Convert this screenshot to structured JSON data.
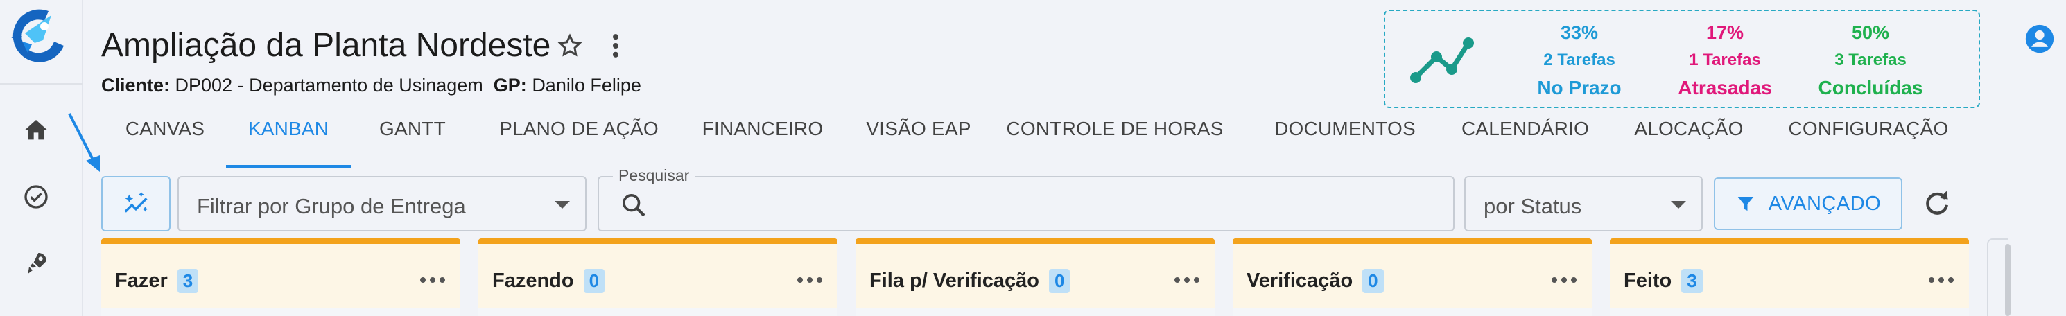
{
  "project": {
    "title": "Ampliação da Planta Nordeste",
    "client_label": "Cliente:",
    "client_value": "DP002 - Departamento de Usinagem",
    "gp_label": "GP:",
    "gp_value": "Danilo Felipe"
  },
  "stats": [
    {
      "pct": "33%",
      "count": "2 Tarefas",
      "label": "No Prazo",
      "color": "#1e9ad6"
    },
    {
      "pct": "17%",
      "count": "1 Tarefas",
      "label": "Atrasadas",
      "color": "#e0187a"
    },
    {
      "pct": "50%",
      "count": "3 Tarefas",
      "label": "Concluídas",
      "color": "#1fb14e"
    }
  ],
  "tabs": [
    "CANVAS",
    "KANBAN",
    "GANTT",
    "PLANO DE AÇÃO",
    "FINANCEIRO",
    "VISÃO EAP",
    "CONTROLE DE HORAS",
    "DOCUMENTOS",
    "CALENDÁRIO",
    "ALOCAÇÃO",
    "CONFIGURAÇÃO"
  ],
  "active_tab": "KANBAN",
  "filters": {
    "group_placeholder": "Filtrar por Grupo de Entrega",
    "search_label": "Pesquisar",
    "search_value": "",
    "status_select": "por Status",
    "advanced_label": "AVANÇADO"
  },
  "columns": [
    {
      "name": "Fazer",
      "count": "3"
    },
    {
      "name": "Fazendo",
      "count": "0"
    },
    {
      "name": "Fila p/ Verificação",
      "count": "0"
    },
    {
      "name": "Verificação",
      "count": "0"
    },
    {
      "name": "Feito",
      "count": "3"
    }
  ],
  "colors": {
    "accent": "#1e88e5",
    "column_top": "#f3a21b",
    "column_bg": "#fdf6e6",
    "stats_border": "#27a9c3"
  },
  "icons": {
    "logo": "rocket-logo-icon",
    "rail": [
      "home-icon",
      "check-circle-icon",
      "rocket-icon"
    ],
    "header": [
      "star-outline-icon",
      "more-vert-icon",
      "account-circle-icon",
      "trend-chart-icon"
    ],
    "filters": [
      "auto-awesome-icon",
      "search-icon",
      "filter-icon",
      "refresh-icon"
    ],
    "annotation": "pointer-arrow-icon"
  }
}
